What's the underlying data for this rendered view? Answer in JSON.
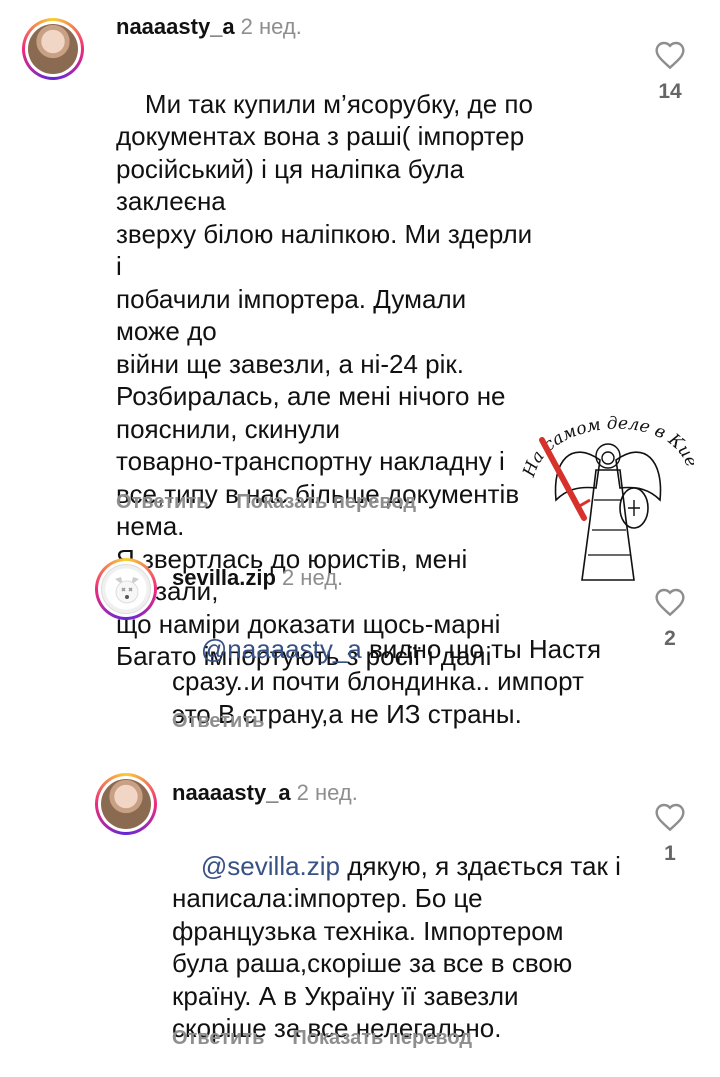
{
  "comments": [
    {
      "username": "naaaasty_a",
      "time": "2 нед.",
      "mention": "",
      "text": "Ми так купили м’ясорубку, де по\nдокументах вона з раші( імпортер\nросійський) і ця наліпка була заклеєна\nзверху білою наліпкою. Ми здерли і\nпобачили імпортера. Думали може до\nвійни ще завезли, а ні-24 рік.\nРозбиралась, але мені нічого не\nпояснили, скинули\nтоварно-транспортну накладну і\nвсе,типу в нас більше документів нема.\nЯ звертлась до юристів, мені сказали,\nщо наміри доказати щось-марні\nБагато імпортують з росії і далі",
      "reply_label": "Ответить",
      "translate_label": "Показать перевод",
      "likes": "14"
    },
    {
      "username": "sevilla.zip",
      "time": "2 нед.",
      "mention": "@naaaasty_a",
      "text": " видно шо ты Настя\nсразу..и почти блондинка.. импорт\nэто В страну,а не ИЗ страны.",
      "reply_label": "Ответить",
      "likes": "2"
    },
    {
      "username": "naaaasty_a",
      "time": "2 нед.",
      "mention": "@sevilla.zip",
      "text": " дякую, я здається так і\nнаписала:імпортер. Бо це\nфранцузька техніка. Імпортером\nбула раша,скоріше за все в свою\nкраїну. А в Україну її завезли\nскоріше за все нелегально.",
      "reply_label": "Ответить",
      "translate_label": "Показать перевод",
      "likes": "1"
    }
  ],
  "watermark": {
    "text": "На самом деле в Киеве",
    "color": "#111111",
    "accent": "#d6312b"
  },
  "colors": {
    "mention": "#385185",
    "muted": "#8e8e8e"
  }
}
